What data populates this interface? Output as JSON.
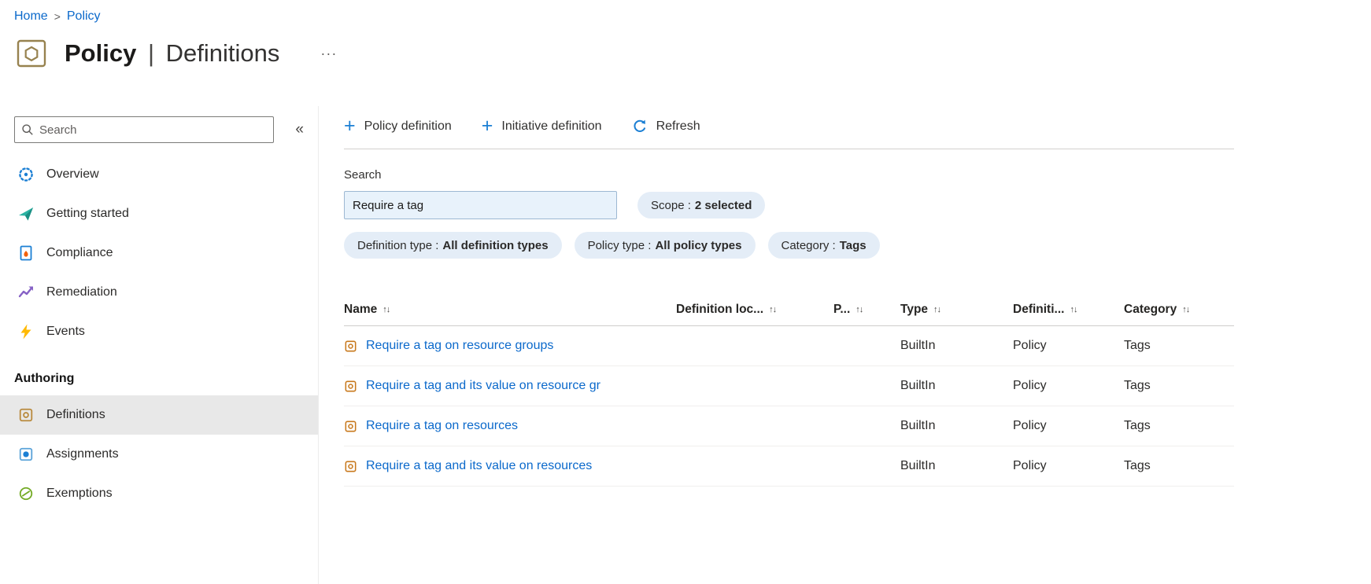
{
  "colors": {
    "accent": "#0078d4",
    "link": "#0b69cb",
    "pill_bg": "#e4edf7",
    "search_fill": "#e8f2fb",
    "selected_item_bg": "#e8e8e8"
  },
  "icons": {
    "breadcrumb_separator": ">",
    "more": "···",
    "collapse": "«",
    "add": "+",
    "sort": "↑↓"
  },
  "breadcrumb": {
    "home": "Home",
    "current": "Policy"
  },
  "header": {
    "title": "Policy",
    "separator": "|",
    "subtitle": "Definitions"
  },
  "sidebar": {
    "search_placeholder": "Search",
    "items": [
      {
        "label": "Overview"
      },
      {
        "label": "Getting started"
      },
      {
        "label": "Compliance"
      },
      {
        "label": "Remediation"
      },
      {
        "label": "Events"
      }
    ],
    "authoring": {
      "label": "Authoring",
      "items": [
        {
          "label": "Definitions"
        },
        {
          "label": "Assignments"
        },
        {
          "label": "Exemptions"
        }
      ]
    }
  },
  "toolbar": {
    "policy_definition": "Policy definition",
    "initiative_definition": "Initiative definition",
    "refresh": "Refresh"
  },
  "filters": {
    "search_label": "Search",
    "search_value": "Require a tag",
    "scope_pill": {
      "name": "Scope :",
      "value": "2 selected"
    },
    "pills": [
      {
        "name": "Definition type :",
        "value": "All definition types"
      },
      {
        "name": "Policy type :",
        "value": "All policy types"
      },
      {
        "name": "Category :",
        "value": "Tags"
      }
    ]
  },
  "table": {
    "columns": {
      "name": "Name",
      "definition_location": "Definition loc...",
      "policies": "P...",
      "type": "Type",
      "definition_type": "Definiti...",
      "category": "Category"
    },
    "rows": [
      {
        "name": "Require a tag on resource groups",
        "type": "BuiltIn",
        "definition_type": "Policy",
        "category": "Tags"
      },
      {
        "name": "Require a tag and its value on resource gr",
        "type": "BuiltIn",
        "definition_type": "Policy",
        "category": "Tags"
      },
      {
        "name": "Require a tag on resources",
        "type": "BuiltIn",
        "definition_type": "Policy",
        "category": "Tags"
      },
      {
        "name": "Require a tag and its value on resources",
        "type": "BuiltIn",
        "definition_type": "Policy",
        "category": "Tags"
      }
    ]
  }
}
